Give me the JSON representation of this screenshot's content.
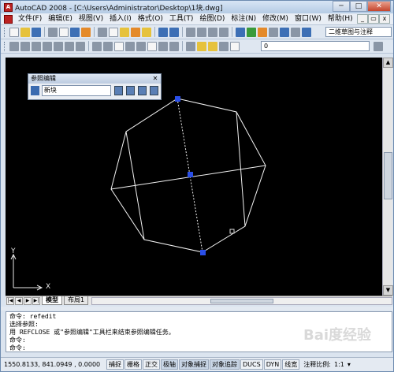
{
  "window": {
    "title": "AutoCAD 2008 - [C:\\Users\\Administrator\\Desktop\\1块.dwg]",
    "buttons": {
      "minimize": "─",
      "maximize": "□",
      "close": "✕"
    }
  },
  "menubar": {
    "items": [
      "文件(F)",
      "编辑(E)",
      "视图(V)",
      "插入(I)",
      "格式(O)",
      "工具(T)",
      "绘图(D)",
      "标注(N)",
      "修改(M)",
      "窗口(W)",
      "帮助(H)"
    ],
    "mdi_buttons": {
      "minimize": "_",
      "restore": "▭",
      "close": "x"
    }
  },
  "toolbar": {
    "workspace_combo": "二维草图与注释",
    "layer_combo": "0"
  },
  "ref_edit_panel": {
    "title": "参照编辑",
    "field_value": "新块",
    "close_label": "✕"
  },
  "canvas": {
    "ucs_x_label": "X",
    "ucs_y_label": "Y"
  },
  "tabs": {
    "nav_buttons": [
      "|◀",
      "◀",
      "▶",
      "▶|"
    ],
    "items": [
      "模型",
      "布局1"
    ]
  },
  "command_lines": [
    "命令: refedit",
    "选择参照:",
    "用 REFCLOSE 或\"参照编辑\"工具栏来结束参照编辑任务。",
    "命令:",
    "命令:"
  ],
  "status": {
    "coords": "1550.8133, 841.0949 , 0.0000",
    "toggles": [
      "捕捉",
      "栅格",
      "正交",
      "极轴",
      "对象捕捉",
      "对象追踪",
      "DUCS",
      "DYN",
      "线宽"
    ],
    "active_toggles": [
      "极轴",
      "对象捕捉",
      "对象追踪"
    ],
    "annotation_scale_label": "注释比例:",
    "annotation_scale_value": "1:1"
  },
  "watermark": "Bai度经验"
}
